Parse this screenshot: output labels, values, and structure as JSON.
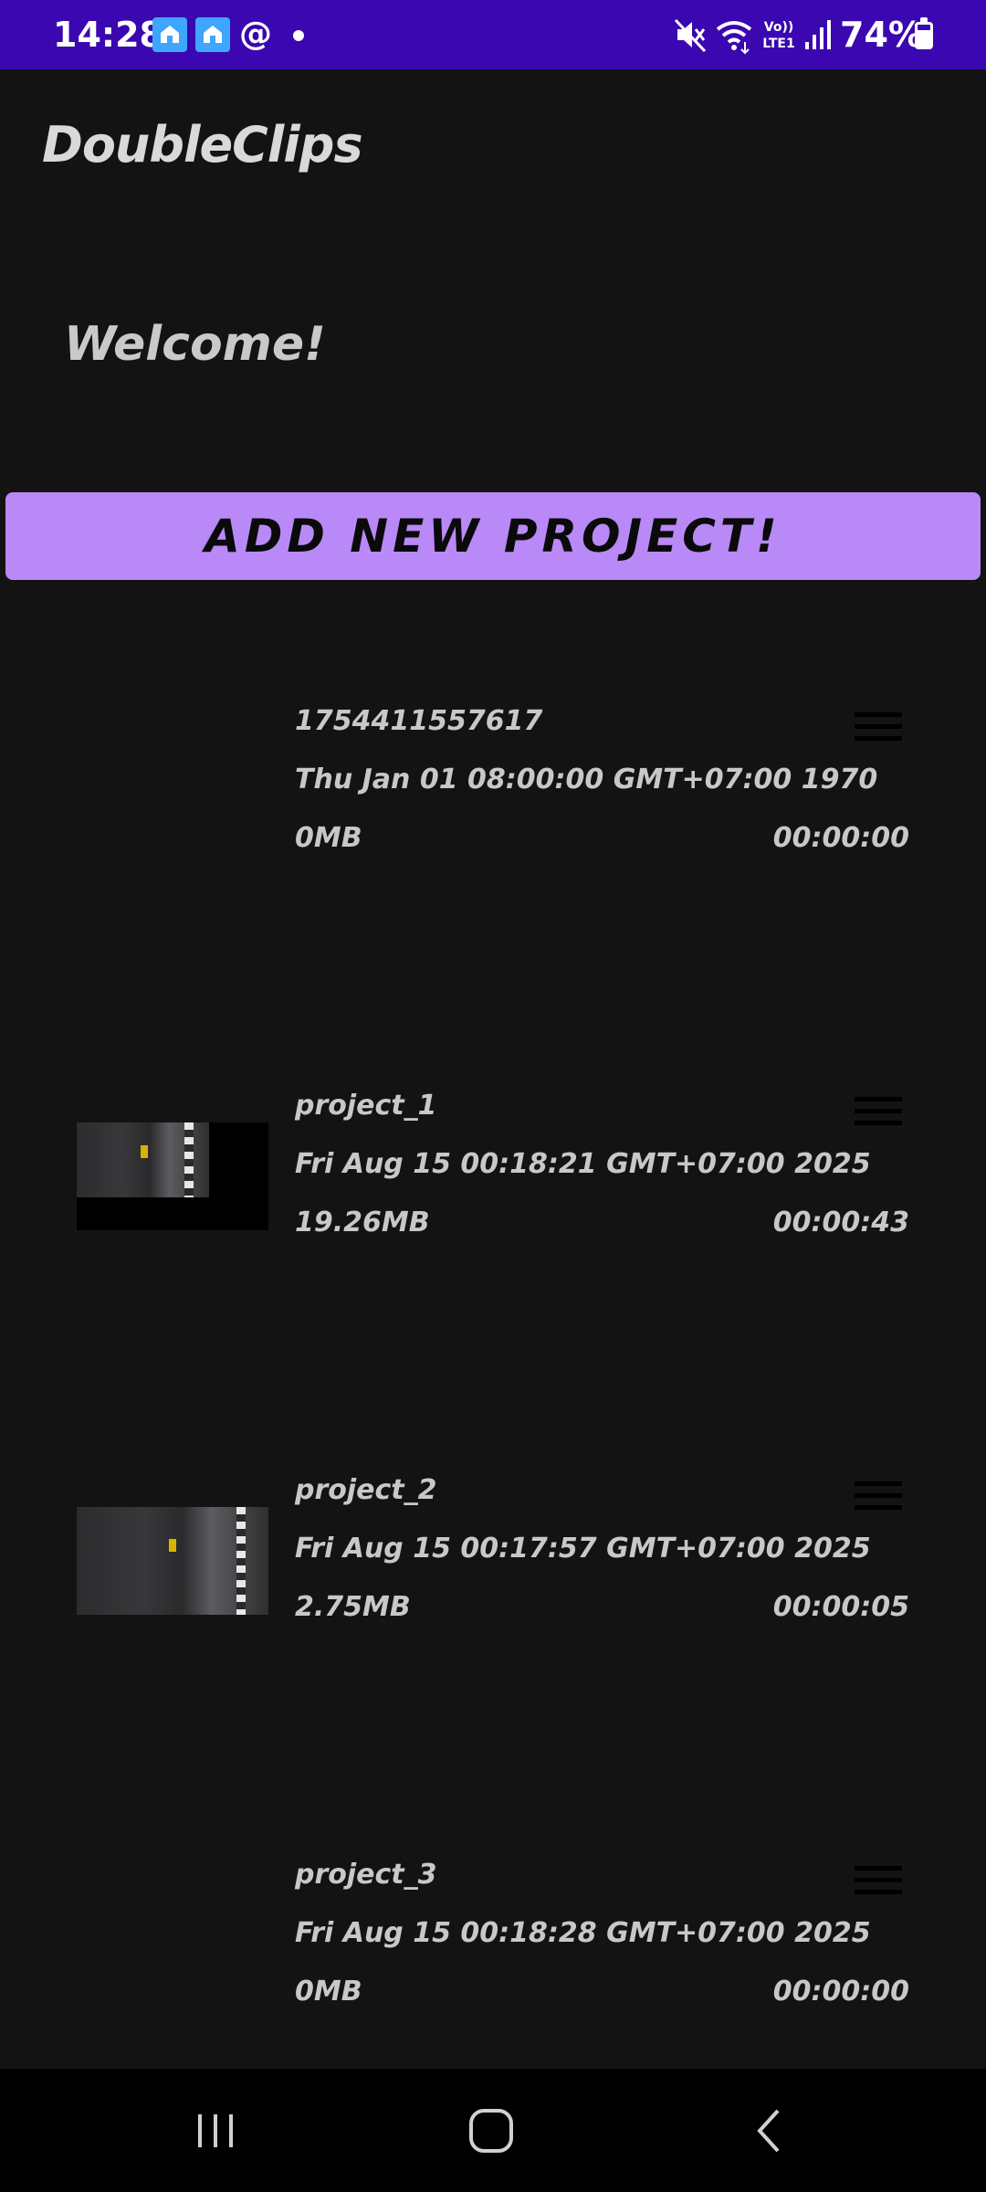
{
  "status_bar": {
    "time": "14:28",
    "battery_percent": "74%",
    "notification_icons": [
      "home-notification-icon",
      "home-notification-icon",
      "threads-icon"
    ],
    "status_icons": [
      "mute-icon",
      "wifi-icon",
      "volte-icon",
      "signal-icon",
      "battery-icon"
    ],
    "color": "#3a07b0"
  },
  "app": {
    "title": "DoubleClips",
    "welcome": "Welcome!",
    "add_button_label": "ADD NEW PROJECT!",
    "accent_color": "#b889f7"
  },
  "projects": [
    {
      "name": "1754411557617",
      "date": "Thu Jan 01 08:00:00 GMT+07:00 1970",
      "size": "0MB",
      "duration": "00:00:00",
      "has_thumbnail": false
    },
    {
      "name": "project_1",
      "date": "Fri Aug 15 00:18:21 GMT+07:00 2025",
      "size": "19.26MB",
      "duration": "00:00:43",
      "has_thumbnail": true
    },
    {
      "name": "project_2",
      "date": "Fri Aug 15 00:17:57 GMT+07:00 2025",
      "size": "2.75MB",
      "duration": "00:00:05",
      "has_thumbnail": true
    },
    {
      "name": "project_3",
      "date": "Fri Aug 15 00:18:28 GMT+07:00 2025",
      "size": "0MB",
      "duration": "00:00:00",
      "has_thumbnail": false
    }
  ],
  "nav_bar": {
    "buttons": [
      "recent-apps-icon",
      "home-icon",
      "back-icon"
    ]
  }
}
